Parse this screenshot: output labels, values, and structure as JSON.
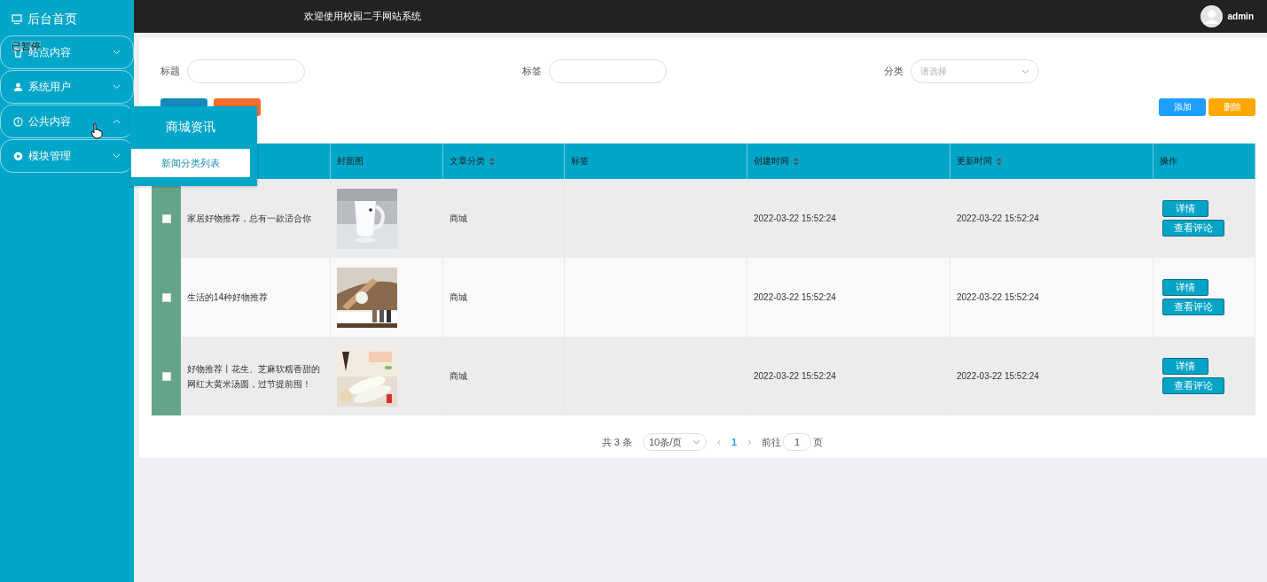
{
  "sidebar": {
    "home": "后台首页",
    "paused_label": "已暂停",
    "items": [
      {
        "label": "站点内容",
        "expanded": false
      },
      {
        "label": "系统用户",
        "expanded": false
      },
      {
        "label": "公共内容",
        "expanded": true
      },
      {
        "label": "模块管理",
        "expanded": false
      }
    ]
  },
  "submenu": {
    "title": "商城资讯",
    "items": [
      {
        "label": "新闻分类列表",
        "selected": true
      }
    ]
  },
  "header": {
    "title": "欢迎使用校园二手网站系统",
    "user": "admin"
  },
  "search": {
    "fields": [
      {
        "label": "标题",
        "kind": "input"
      },
      {
        "label": "标签",
        "kind": "input"
      },
      {
        "label": "分类",
        "kind": "select",
        "placeholder": "请选择"
      }
    ]
  },
  "toolbar": {
    "right_buttons": [
      {
        "label": "添加",
        "kind": "add"
      },
      {
        "label": "删除",
        "kind": "delete"
      }
    ]
  },
  "table": {
    "columns": [
      {
        "label": "封面图",
        "sortable": false
      },
      {
        "label": "文章分类",
        "sortable": true
      },
      {
        "label": "标签",
        "sortable": false
      },
      {
        "label": "创建时间",
        "sortable": true
      },
      {
        "label": "更新时间",
        "sortable": true
      },
      {
        "label": "操作",
        "sortable": false
      }
    ],
    "rows": [
      {
        "checked": false,
        "title": "家居好物推荐，总有一款适合你",
        "cover": {
          "kind": "picture"
        },
        "category": "商城",
        "created": "2022-03-22 15:52:24",
        "updated": "2022-03-22 15:52:24",
        "actions": [
          "详情",
          "查看评论"
        ]
      },
      {
        "checked": false,
        "title": "生活的14种好物推荐",
        "cover": {
          "kind": "picture"
        },
        "category": "商城",
        "created": "2022-03-22 15:52:24",
        "updated": "2022-03-22 15:52:24",
        "actions": [
          "详情",
          "查看评论"
        ]
      },
      {
        "checked": false,
        "title": "好物推荐丨花生、芝麻软糯香甜的网红大黄米汤圆，过节提前囤！",
        "cover": {
          "kind": "picture"
        },
        "category": "商城",
        "created": "2022-03-22 15:52:24",
        "updated": "2022-03-22 15:52:24",
        "actions": [
          "详情",
          "查看评论"
        ]
      }
    ]
  },
  "pagination": {
    "total": "共 3 条",
    "page_size": "10条/页",
    "prev": "‹",
    "pages": [
      {
        "label": "1",
        "selected": true
      }
    ],
    "next": "›",
    "goto_label": "前往",
    "goto_value": "1",
    "goto_suffix": "页"
  }
}
